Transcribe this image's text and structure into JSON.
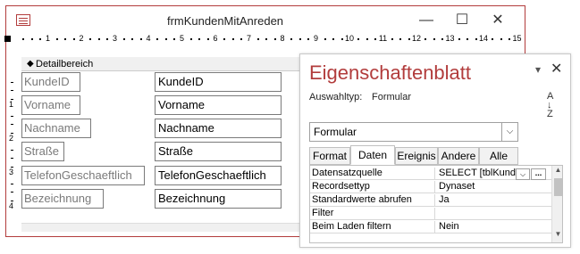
{
  "form_window": {
    "title": "frmKundenMitAnreden",
    "minimize": "—",
    "maximize": "☐",
    "close": "✕"
  },
  "ruler": {
    "numbers": [
      "1",
      "2",
      "3",
      "4",
      "5",
      "6",
      "7",
      "8",
      "9",
      "10",
      "11",
      "12",
      "13",
      "14",
      "15"
    ],
    "vertical": [
      "1",
      "2",
      "3",
      "4"
    ]
  },
  "detail_section": {
    "label": "Detailbereich"
  },
  "fields": [
    {
      "label": "KundeID",
      "value": "KundeID"
    },
    {
      "label": "Vorname",
      "value": "Vorname"
    },
    {
      "label": "Nachname",
      "value": "Nachname"
    },
    {
      "label": "Straße",
      "value": "Straße"
    },
    {
      "label": "TelefonGeschaeftlich",
      "value": "TelefonGeschaeftlich"
    },
    {
      "label": "Bezeichnung",
      "value": "Bezeichnung"
    }
  ],
  "property_sheet": {
    "title": "Eigenschaftenblatt",
    "selection_type_label": "Auswahltyp:",
    "selection_type_value": "Formular",
    "sort_icon": "A↓Z",
    "pin": "▾",
    "close": "✕",
    "object_combo": {
      "value": "Formular",
      "button": "⌵"
    },
    "tabs": [
      "Format",
      "Daten",
      "Ereignis",
      "Andere",
      "Alle"
    ],
    "active_tab": "Daten",
    "properties": [
      {
        "name": "Datensatzquelle",
        "value": "SELECT [tblKunde"
      },
      {
        "name": "Recordsettyp",
        "value": "Dynaset"
      },
      {
        "name": "Standardwerte abrufen",
        "value": "Ja"
      },
      {
        "name": "Filter",
        "value": ""
      },
      {
        "name": "Beim Laden filtern",
        "value": "Nein"
      }
    ],
    "dropdown_button": "⌵",
    "builder_button": "..."
  },
  "colors": {
    "accent": "#b23c3c",
    "border": "#7a7a7a",
    "panel_bg": "#ffffff"
  }
}
